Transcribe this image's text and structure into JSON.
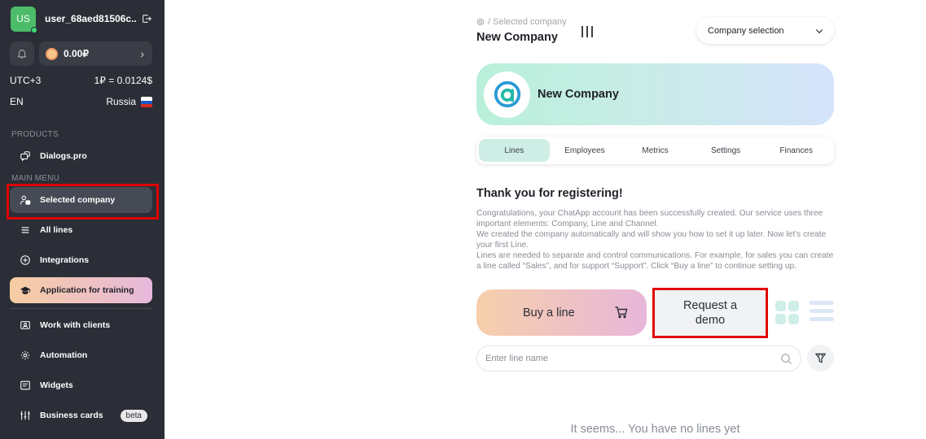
{
  "user": {
    "initials": "US",
    "name": "user_68aed81506c..."
  },
  "balance": {
    "amount": "0.00₽"
  },
  "settings": {
    "timezone": "UTC+3",
    "rate": "1₽ = 0.0124$",
    "language": "EN",
    "country": "Russia"
  },
  "sidebar": {
    "products_label": "PRODUCTS",
    "product_item": "Dialogs.pro",
    "main_menu_label": "MAIN MENU",
    "items": [
      {
        "label": "Selected company",
        "icon": "company-icon"
      },
      {
        "label": "All lines",
        "icon": "lines-icon"
      },
      {
        "label": "Integrations",
        "icon": "plus-circle-icon"
      },
      {
        "label": "Application for training",
        "icon": "graduation-cap-icon"
      },
      {
        "label": "Work with clients",
        "icon": "contact-card-icon"
      },
      {
        "label": "Automation",
        "icon": "automation-icon"
      },
      {
        "label": "Widgets",
        "icon": "widget-icon"
      },
      {
        "label": "Business cards",
        "icon": "sliders-icon",
        "badge": "beta"
      }
    ]
  },
  "header": {
    "breadcrumb": "Selected company",
    "title": "New Company",
    "company_select": "Company selection"
  },
  "banner": {
    "company_name": "New Company"
  },
  "tabs": [
    "Lines",
    "Employees",
    "Metrics",
    "Settings",
    "Finances"
  ],
  "welcome": {
    "title": "Thank you for registering!",
    "p1": "Congratulations, your ChatApp account has been successfully created. Our service uses three important elements: Company, Line and Channel.",
    "p2": "We created the company automatically and will show you how to set it up later. Now let's create your first Line.",
    "p3": "Lines are needed to separate and control communications. For example, for sales you can create a line called “Sales”, and for support “Support”. Click “Buy a line” to continue setting up."
  },
  "actions": {
    "buy_line": "Buy a line",
    "request_demo": "Request a demo"
  },
  "search": {
    "placeholder": "Enter line name"
  },
  "empty_state": "It seems... You have no lines yet",
  "colors": {
    "sidebar_bg": "#2b2e36",
    "accent_green": "#4cbb6a",
    "highlight_red": "#e00000",
    "tab_active": "#cfeee5"
  }
}
